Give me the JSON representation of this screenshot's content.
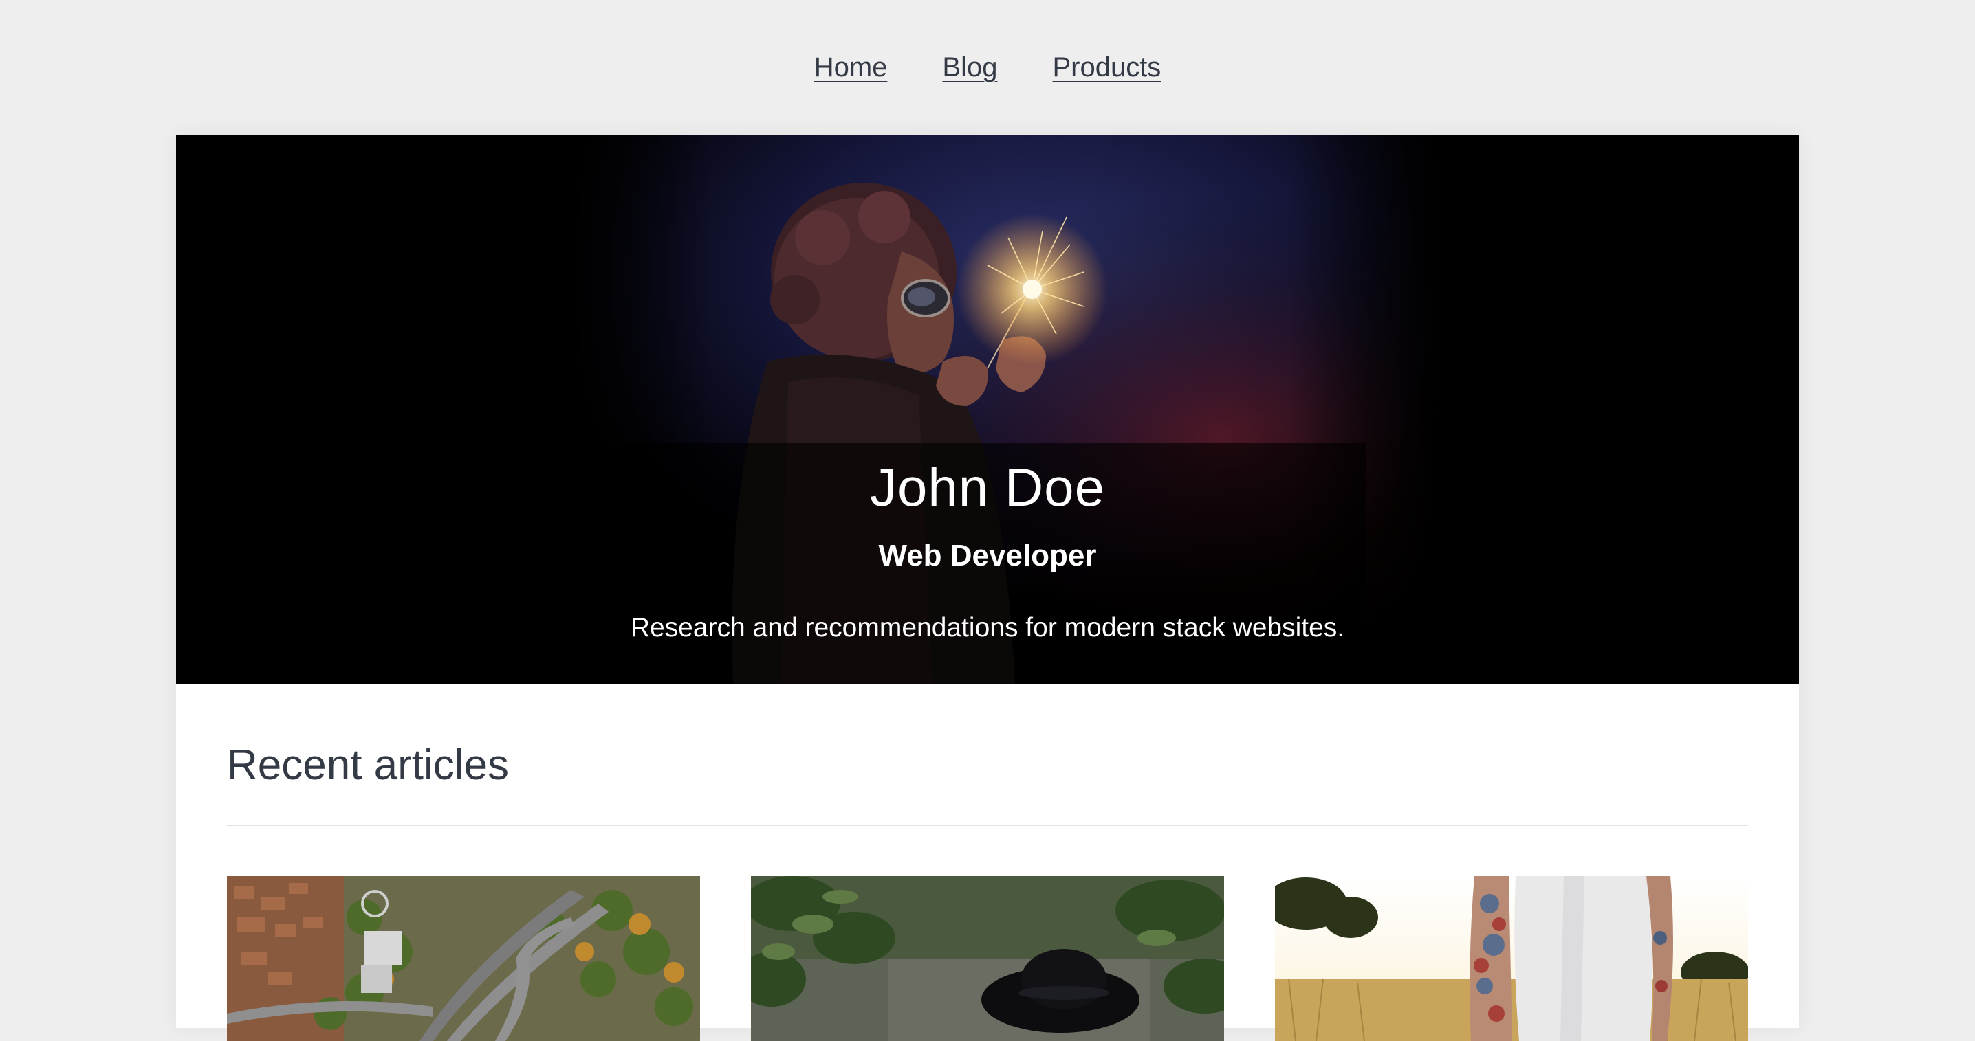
{
  "nav": {
    "items": [
      {
        "label": "Home"
      },
      {
        "label": "Blog"
      },
      {
        "label": "Products"
      }
    ]
  },
  "hero": {
    "name": "John Doe",
    "role": "Web Developer",
    "tagline": "Research and recommendations for modern stack websites.",
    "image": "person-with-sparkler-photo"
  },
  "articles": {
    "heading": "Recent articles",
    "thumbnails": [
      {
        "image": "aerial-city-highway-photo"
      },
      {
        "image": "person-in-black-hat-forest-photo"
      },
      {
        "image": "tattooed-person-field-photo"
      }
    ]
  },
  "colors": {
    "page_background": "#eeeeee",
    "card_background": "#ffffff",
    "text": "#333a45",
    "hero_background": "#000000"
  }
}
